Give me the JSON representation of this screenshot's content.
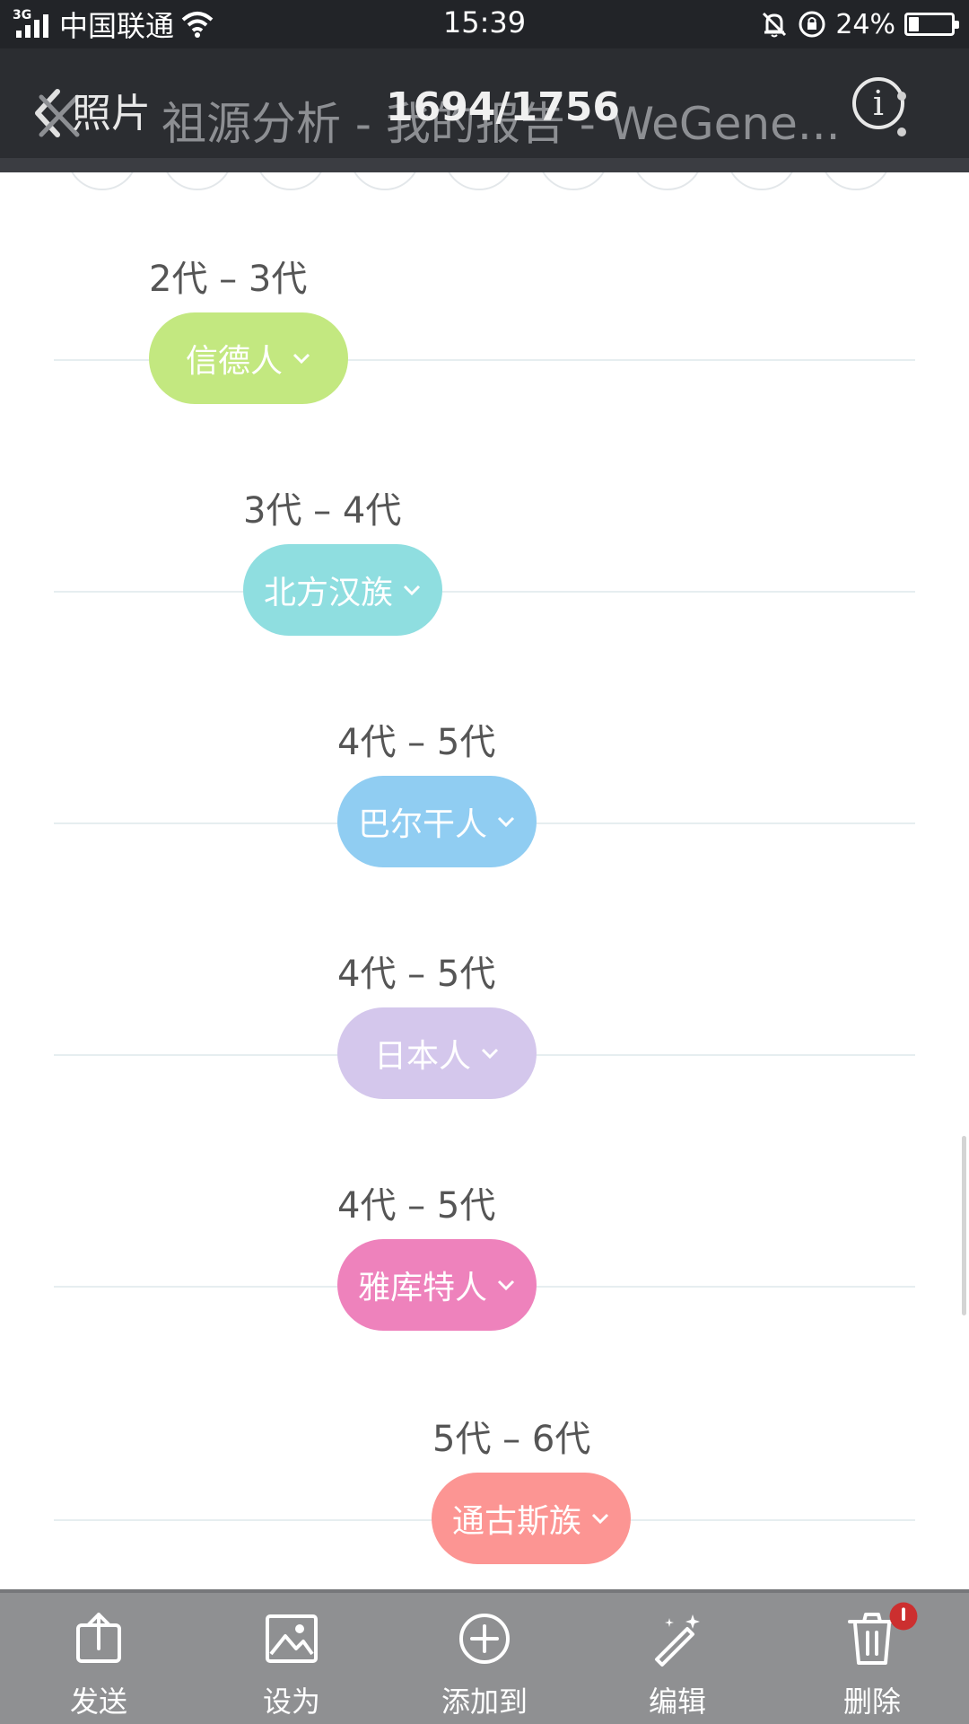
{
  "status_bar": {
    "network_type": "3G",
    "carrier": "中国联通",
    "time": "15:39",
    "battery_percent": "24%",
    "battery_level": 0.24,
    "icons": [
      "signal-icon",
      "wifi-icon",
      "mute-bell-icon",
      "rotation-lock-icon",
      "battery-icon"
    ]
  },
  "title_bar": {
    "album_label": "照片",
    "counter": "1694/1756",
    "page_title": "祖源分析 - 我的报告 - WeGene...",
    "info_label": "i",
    "icons": [
      "back-chevron-icon",
      "close-x-icon",
      "info-icon",
      "more-vert-icon"
    ]
  },
  "timeline": {
    "items": [
      {
        "generation": "2代 – 3代",
        "population": "信德人",
        "color": "#c3e880"
      },
      {
        "generation": "3代 – 4代",
        "population": "北方汉族",
        "color": "#8fdee0"
      },
      {
        "generation": "4代 – 5代",
        "population": "巴尔干人",
        "color": "#90cdf2"
      },
      {
        "generation": "4代 – 5代",
        "population": "日本人",
        "color": "#d4c7ec"
      },
      {
        "generation": "4代 – 5代",
        "population": "雅库特人",
        "color": "#ee82bc"
      },
      {
        "generation": "5代 – 6代",
        "population": "通古斯族",
        "color": "#fc9593"
      }
    ]
  },
  "toolbar": {
    "items": [
      {
        "label": "发送",
        "icon": "send-icon"
      },
      {
        "label": "设为",
        "icon": "set-as-icon"
      },
      {
        "label": "添加到",
        "icon": "add-to-icon"
      },
      {
        "label": "编辑",
        "icon": "edit-magic-icon"
      },
      {
        "label": "删除",
        "icon": "delete-icon"
      }
    ],
    "badge_color": "#cc2f2f"
  }
}
